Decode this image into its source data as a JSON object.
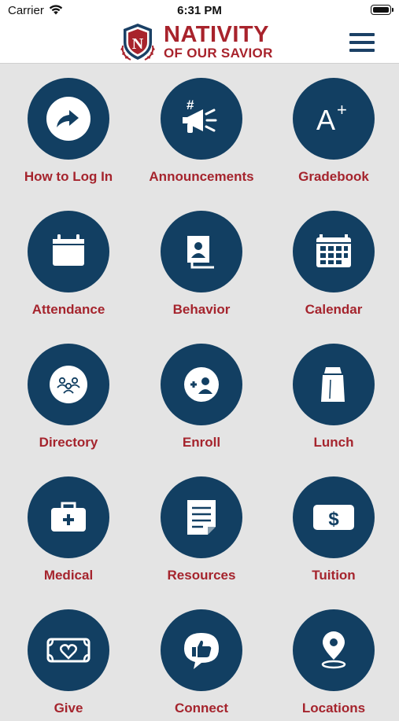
{
  "status_bar": {
    "carrier": "Carrier",
    "time": "6:31 PM"
  },
  "header": {
    "brand_line1": "NATIVITY",
    "brand_line2": "OF OUR SAVIOR",
    "crest_letter": "N"
  },
  "tiles": [
    {
      "label": "How to Log In",
      "icon": "share-arrow-icon"
    },
    {
      "label": "Announcements",
      "icon": "megaphone-icon"
    },
    {
      "label": "Gradebook",
      "icon": "a-plus-icon"
    },
    {
      "label": "Attendance",
      "icon": "calendar-page-icon"
    },
    {
      "label": "Behavior",
      "icon": "profile-cards-icon"
    },
    {
      "label": "Calendar",
      "icon": "calendar-grid-icon"
    },
    {
      "label": "Directory",
      "icon": "group-people-icon"
    },
    {
      "label": "Enroll",
      "icon": "add-user-icon"
    },
    {
      "label": "Lunch",
      "icon": "lunch-bag-icon"
    },
    {
      "label": "Medical",
      "icon": "medical-kit-icon"
    },
    {
      "label": "Resources",
      "icon": "document-icon"
    },
    {
      "label": "Tuition",
      "icon": "dollar-bill-icon"
    },
    {
      "label": "Give",
      "icon": "heart-ticket-icon"
    },
    {
      "label": "Connect",
      "icon": "thumbs-up-bubble-icon"
    },
    {
      "label": "Locations",
      "icon": "map-pin-icon"
    }
  ],
  "colors": {
    "circle": "#123f62",
    "label": "#a5242d",
    "brand": "#a8232c",
    "background": "#e4e4e4"
  }
}
